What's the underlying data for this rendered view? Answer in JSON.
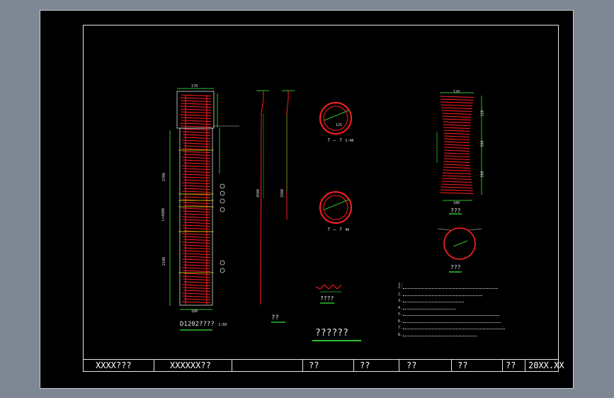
{
  "title_block": {
    "cells": [
      "XXXX???",
      "XXXXXX??",
      "??",
      "??",
      "??",
      "??",
      "??",
      "20XX.XX"
    ]
  },
  "drawing": {
    "pile_label": "D1202????",
    "pile_scale": "1:60",
    "rebar_label": "??",
    "section1_label": "? — ?",
    "section1_scale": "1:40",
    "section2_label": "? — ?",
    "section2_scale": "40",
    "spiral_label": "????",
    "main_title": "??????",
    "right_elev_label": "???",
    "right_section_label": "???",
    "notes_heading": "?:",
    "note_markers": [
      "1.",
      "2.",
      "3.",
      "4.",
      "5.",
      "6.",
      "7.",
      "8."
    ],
    "dims": {
      "top_width": "170",
      "bottom_width": "180",
      "left_upper": "2700",
      "left_total": "L=4800",
      "left_lower": "2100",
      "rebar_len1": "4500",
      "rebar_len2": "2500",
      "right_top": "120",
      "right_bottom": "180",
      "right_d1": "120",
      "right_d2": "200",
      "right_d3": "200",
      "sec_dim": "125"
    }
  },
  "colors": {
    "background": "#7e8794",
    "sheet": "#000000",
    "rebar": "#ff2020",
    "dimension": "#2fbf2f",
    "text": "#e6e6e6"
  }
}
